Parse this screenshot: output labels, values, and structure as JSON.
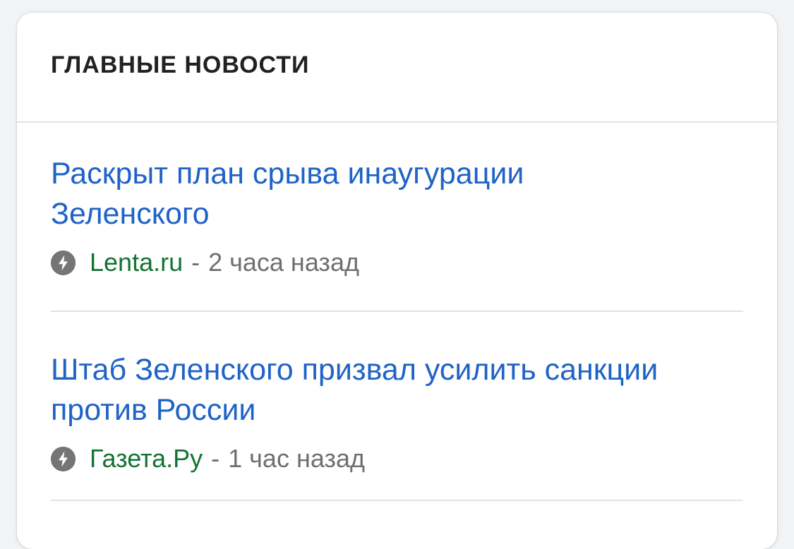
{
  "card": {
    "title": "ГЛАВНЫЕ НОВОСТИ"
  },
  "news": [
    {
      "headline": "Раскрыт план срыва инаугурации Зеленского",
      "source": "Lenta.ru",
      "separator": "-",
      "time": "2 часа назад",
      "icon": "amp-lightning-icon"
    },
    {
      "headline": "Штаб Зеленского призвал усилить санкции против России",
      "source": "Газета.Ру",
      "separator": "-",
      "time": "1 час назад",
      "icon": "amp-lightning-icon"
    }
  ],
  "colors": {
    "headline": "#1f63c7",
    "source": "#137333",
    "meta": "#6f6f6f",
    "title": "#202124",
    "amp_icon_bg": "#757575"
  }
}
